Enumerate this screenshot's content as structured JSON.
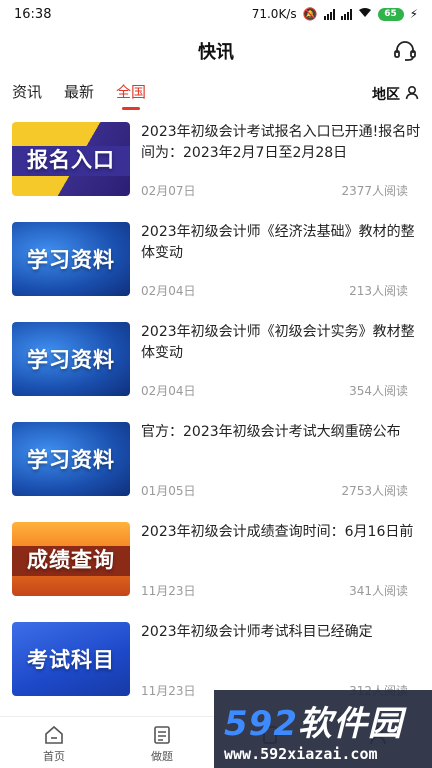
{
  "status_bar": {
    "time": "16:38",
    "net_speed": "71.0K/s",
    "battery": "65"
  },
  "header": {
    "title": "快讯",
    "support_icon": "headset-icon"
  },
  "tabs": [
    {
      "label": "资讯",
      "active": false
    },
    {
      "label": "最新",
      "active": false
    },
    {
      "label": "全国",
      "active": true
    }
  ],
  "region": {
    "label": "地区",
    "icon": "user-location-icon"
  },
  "news": [
    {
      "thumb_label": "报名入口",
      "title": "2023年初级会计考试报名入口已开通!报名时间为：2023年2月7日至2月28日",
      "date": "02月07日",
      "views": "2377人阅读"
    },
    {
      "thumb_label": "学习资料",
      "title": "2023年初级会计师《经济法基础》教材的整体变动",
      "date": "02月04日",
      "views": "213人阅读"
    },
    {
      "thumb_label": "学习资料",
      "title": "2023年初级会计师《初级会计实务》教材整体变动",
      "date": "02月04日",
      "views": "354人阅读"
    },
    {
      "thumb_label": "学习资料",
      "title": "官方：2023年初级会计考试大纲重磅公布",
      "date": "01月05日",
      "views": "2753人阅读"
    },
    {
      "thumb_label": "成绩查询",
      "title": "2023年初级会计成绩查询时间：6月16日前",
      "date": "11月23日",
      "views": "341人阅读"
    },
    {
      "thumb_label": "考试科目",
      "title": "2023年初级会计师考试科目已经确定",
      "date": "11月23日",
      "views": "312人阅读"
    }
  ],
  "bottom_nav": [
    {
      "label": "首页",
      "icon": "home-icon"
    },
    {
      "label": "做题",
      "icon": "practice-icon"
    },
    {
      "label": "",
      "icon": "document-icon"
    },
    {
      "label": "",
      "icon": "profile-icon"
    }
  ],
  "watermark": {
    "brand_num": "592",
    "brand_text": "软件园",
    "url": "www.592xiazai.com"
  },
  "colors": {
    "accent": "#e0392b",
    "meta_text": "#999999"
  }
}
